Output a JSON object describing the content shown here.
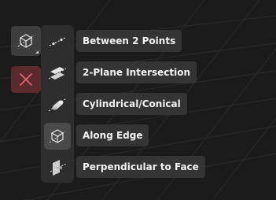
{
  "colors": {
    "background": "#1b1b1b",
    "grid": "#2a2a2a",
    "tool_button": "#3e3e3e",
    "close_button": "#5c2a2d",
    "close_x": "#e06b73",
    "flyout": "#2e2e2e",
    "label_bg": "#343434",
    "text": "#f2f2f2"
  },
  "toolbar": {
    "active_tool_icon": "box-axis-icon",
    "close_icon": "close-icon"
  },
  "menu": {
    "items": [
      {
        "label": "Between 2 Points",
        "icon": "two-points-line-icon",
        "selected": false
      },
      {
        "label": "2-Plane Intersection",
        "icon": "plane-intersection-icon",
        "selected": false
      },
      {
        "label": "Cylindrical/Conical",
        "icon": "cylinder-axis-icon",
        "selected": false
      },
      {
        "label": "Along Edge",
        "icon": "box-edge-icon",
        "selected": true
      },
      {
        "label": "Perpendicular to Face",
        "icon": "perpendicular-face-icon",
        "selected": false
      }
    ]
  }
}
